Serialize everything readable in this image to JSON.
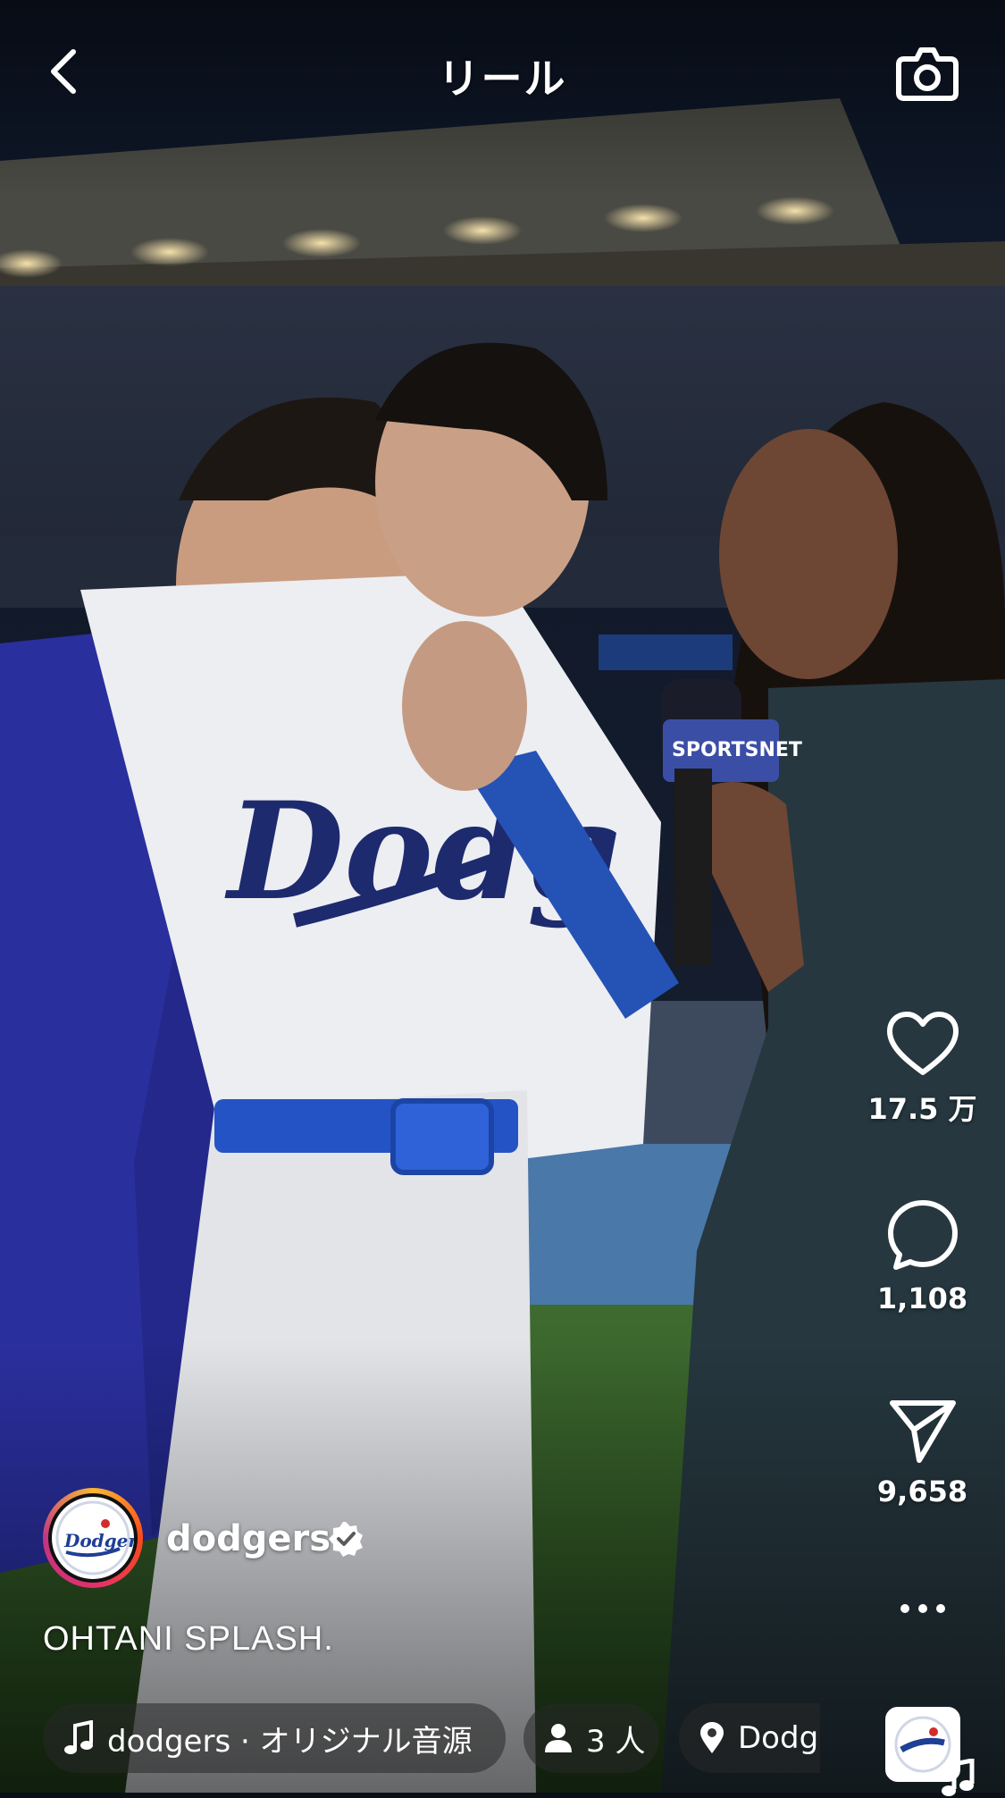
{
  "header": {
    "title": "リール",
    "back_icon": "chevron-left-icon",
    "camera_icon": "camera-icon"
  },
  "post": {
    "username": "dodgers",
    "verified": true,
    "caption": "OHTANI SPLASH."
  },
  "actions": {
    "likes": "17.5 万",
    "comments": "1,108",
    "shares": "9,658",
    "like_icon": "heart-icon",
    "comment_icon": "comment-bubble-icon",
    "share_icon": "send-icon",
    "more_icon": "more-horizontal-icon",
    "audio_icon": "music-note-icon"
  },
  "chips": {
    "audio": "dodgers · オリジナル音源",
    "people": "3 人",
    "location": "Dodg"
  },
  "colors": {
    "text": "#ffffff",
    "dodgers_blue": "#1e3f96",
    "field_green": "#2f5a2a",
    "chip_bg": "rgba(40,40,40,0.55)"
  }
}
